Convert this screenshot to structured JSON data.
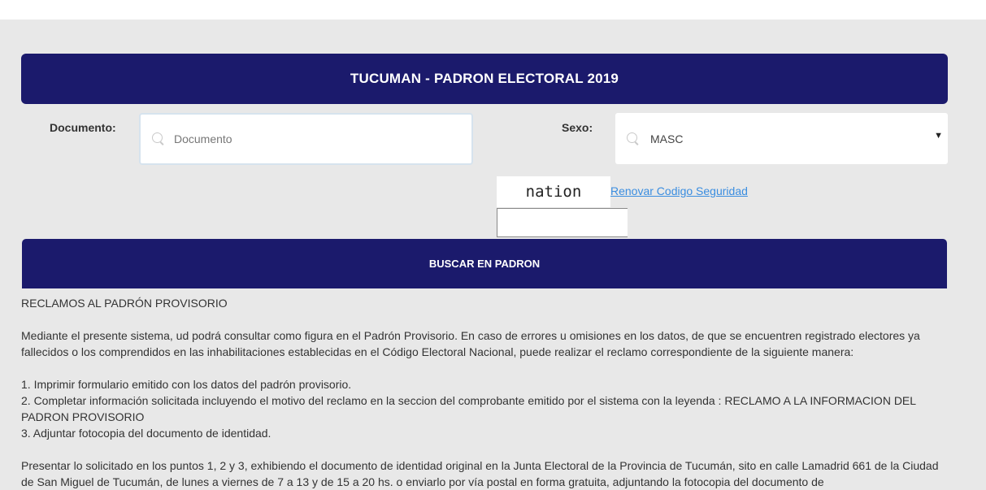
{
  "header": {
    "title": "TUCUMAN - PADRON ELECTORAL 2019"
  },
  "form": {
    "documento_label": "Documento:",
    "documento_placeholder": "Documento",
    "sexo_label": "Sexo:",
    "sexo_selected": "MASC",
    "captcha_text": "nation",
    "renovar_link": "Renovar Codigo Seguridad",
    "search_button": "BUSCAR EN PADRON"
  },
  "content": {
    "heading": "RECLAMOS AL PADRÓN PROVISORIO",
    "intro": "Mediante el presente sistema, ud podrá consultar como figura en el Padrón Provisorio. En caso de errores u omisiones en los datos, de que se encuentren registrado electores ya fallecidos o los comprendidos en las inhabilitaciones establecidas en el Código Electoral Nacional, puede realizar el reclamo correspondiente de la siguiente manera:",
    "step1": "1. Imprimir formulario emitido con los datos del padrón provisorio.",
    "step2": "2. Completar información solicitada incluyendo el motivo del reclamo en la seccion del comprobante emitido por el sistema con la leyenda : RECLAMO A LA INFORMACION DEL PADRON PROVISORIO",
    "step3": "3. Adjuntar fotocopia del documento de identidad.",
    "closing": "Presentar lo solicitado en los puntos 1, 2 y 3, exhibiendo el documento de identidad original en la Junta Electoral de la Provincia de Tucumán, sito en calle Lamadrid 661 de la Ciudad de San Miguel de Tucumán, de lunes a viernes de 7 a 13 y de 15 a 20 hs. o enviarlo por vía postal en forma gratuita, adjuntando la fotocopia del documento de"
  },
  "icons": {
    "search": "search-icon",
    "dropdown": "chevron-down-icon"
  },
  "colors": {
    "primary": "#1b1a6c",
    "link": "#3a8de0",
    "background": "#e8e8e8"
  }
}
